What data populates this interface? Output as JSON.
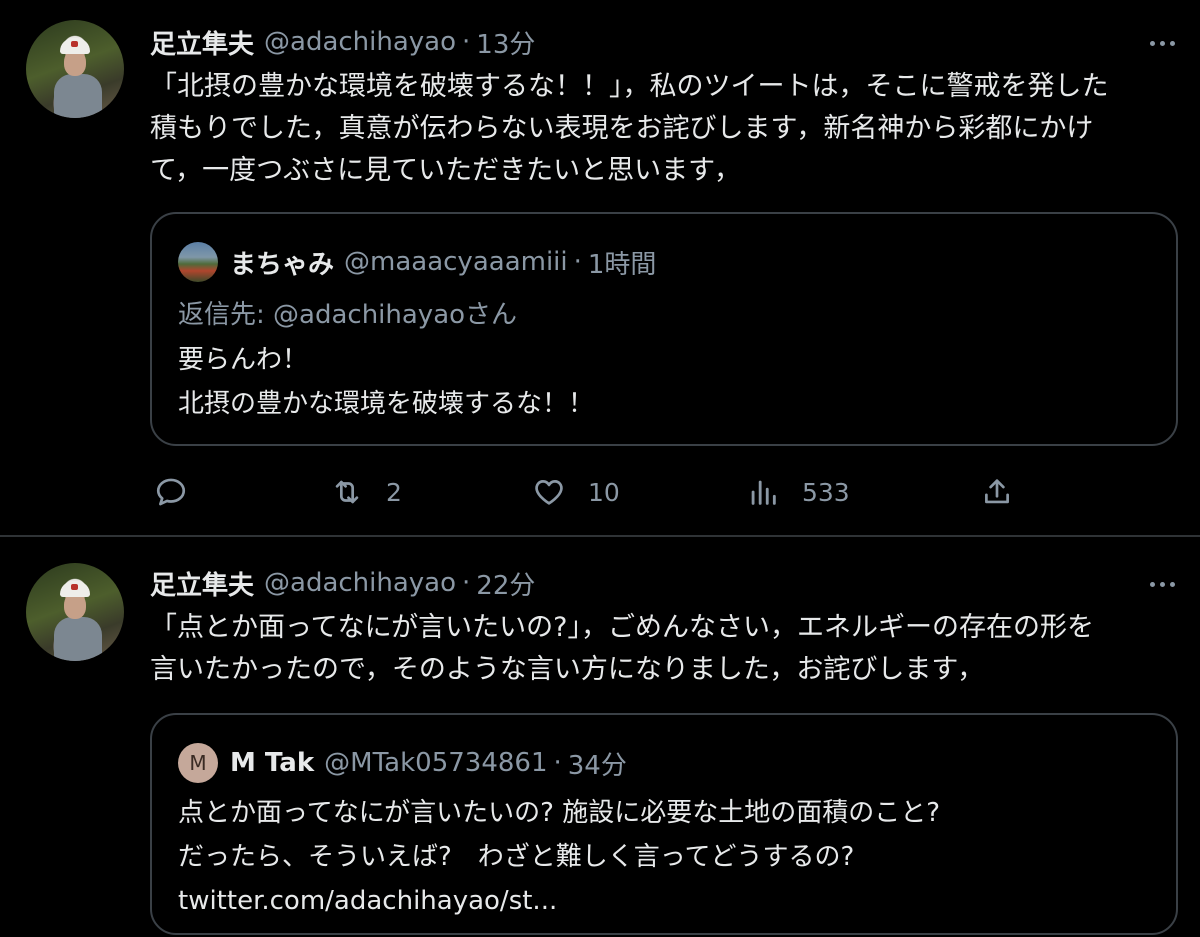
{
  "tweets": [
    {
      "author_name": "足立隼夫",
      "handle": "@adachihayao",
      "separator": "·",
      "time": "13分",
      "text_lines": [
        "「北摂の豊かな環境を破壊するな！！」，私のツイートは，そこに警戒を発した",
        "積もりでした，真意が伝わらない表現をお詫びします，新名神から彩都にかけ",
        "て，一度つぶさに見ていただきたいと思います，"
      ],
      "quote": {
        "author_name": "まちゃみ",
        "handle": "@maaacyaaamiii",
        "separator": "·",
        "time": "1時間",
        "reply_to": "返信先: @adachihayaoさん",
        "text_lines": [
          "要らんわ！",
          "北摂の豊かな環境を破壊するな！！"
        ]
      },
      "actions": {
        "reply_icon": "reply-icon",
        "retweet_icon": "retweet-icon",
        "retweet_count": "2",
        "like_icon": "heart-icon",
        "like_count": "10",
        "views_icon": "bar-chart-icon",
        "views_count": "533",
        "share_icon": "share-icon"
      }
    },
    {
      "author_name": "足立隼夫",
      "handle": "@adachihayao",
      "separator": "·",
      "time": "22分",
      "text_lines": [
        "「点とか面ってなにが言いたいの?」，ごめんなさい，エネルギーの存在の形を",
        "言いたかったので，そのような言い方になりました，お詫びします，"
      ],
      "quote": {
        "avatar_letter": "M",
        "author_name": "M Tak",
        "handle": "@MTak05734861",
        "separator": "·",
        "time": "34分",
        "text_lines": [
          "点とか面ってなにが言いたいの? 施設に必要な土地の面積のこと?",
          "だったら、そういえば?　わざと難しく言ってどうするの?",
          "twitter.com/adachihayao/st..."
        ]
      }
    }
  ],
  "colors": {
    "background": "#000000",
    "text": "#e7e9ea",
    "secondary": "#8b98a5",
    "border": "#3a4046"
  }
}
